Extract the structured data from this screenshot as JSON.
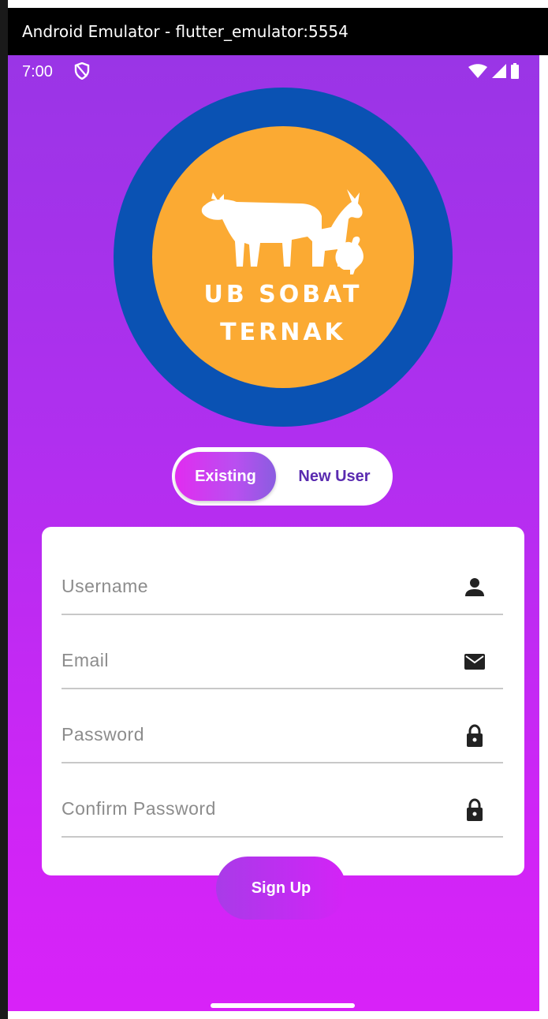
{
  "window": {
    "title": "Android Emulator - flutter_emulator:5554"
  },
  "status_bar": {
    "time": "7:00"
  },
  "logo": {
    "line1": "UB SOBAT",
    "line2": "TERNAK"
  },
  "auth_toggle": {
    "existing_label": "Existing",
    "new_user_label": "New User",
    "selected": "Existing"
  },
  "form": {
    "username_placeholder": "Username",
    "email_placeholder": "Email",
    "password_placeholder": "Password",
    "confirm_password_placeholder": "Confirm Password"
  },
  "actions": {
    "signup_label": "Sign Up"
  },
  "colors": {
    "logo_ring": "#0a52b3",
    "logo_fill": "#fbaa33",
    "background_top": "#9a35e6",
    "background_bottom": "#d822f8"
  }
}
